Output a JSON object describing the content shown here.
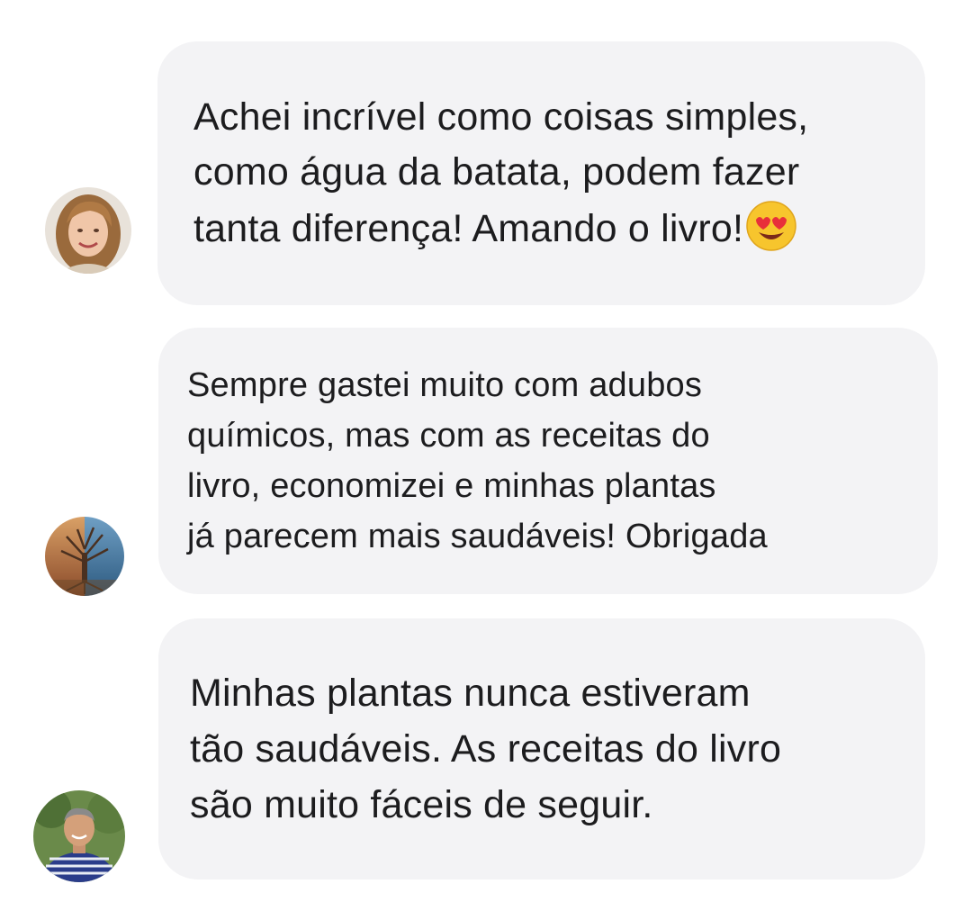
{
  "testimonials": [
    {
      "avatar_icon": "woman-avatar",
      "lines": [
        "Achei incrível como coisas simples,",
        "como água da batata, podem fazer",
        "tanta diferença! Amando o livro!"
      ],
      "trailing_icon": "heart-eyes-emoji-icon"
    },
    {
      "avatar_icon": "tree-avatar",
      "lines": [
        "Sempre gastei muito com adubos",
        "químicos, mas com as receitas do",
        "livro, economizei e minhas plantas",
        "já parecem mais saudáveis! Obrigada"
      ]
    },
    {
      "avatar_icon": "man-avatar",
      "lines": [
        "Minhas plantas nunca estiveram",
        "tão saudáveis. As receitas do livro",
        "são muito fáceis de seguir."
      ]
    }
  ],
  "colors": {
    "bubble_background": "#f3f3f5",
    "text": "#1c1c1e",
    "page_background": "#ffffff"
  }
}
